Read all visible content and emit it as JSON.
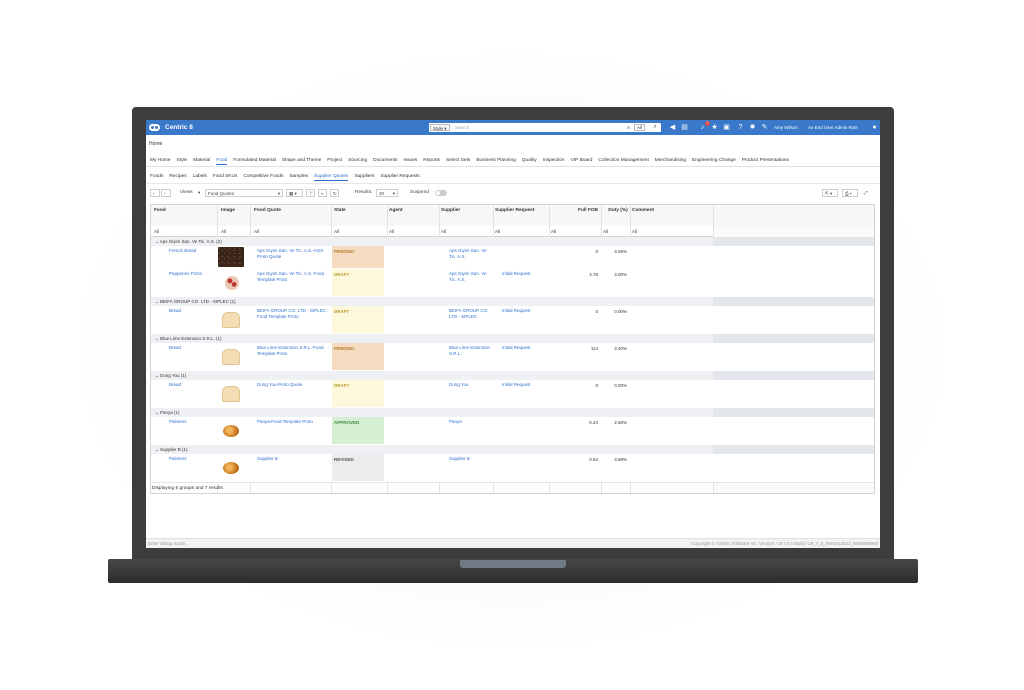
{
  "app": {
    "name": "Centric 8"
  },
  "search": {
    "type": "Style",
    "placeholder": "Search",
    "in_label": "in",
    "scope": "All"
  },
  "user": {
    "name": "Amy Wilson",
    "role": "An End User Admin Role",
    "notifications": "1"
  },
  "breadcrumb": "Home",
  "nav_tabs": [
    "My Home",
    "Style",
    "Material",
    "Food",
    "Formulated Material",
    "Shape and Theme",
    "Project",
    "Sourcing",
    "Documents",
    "Issues",
    "Reports",
    "Select Sets",
    "Business Planning",
    "Quality",
    "Inspection",
    "VIP Board",
    "Collection Management",
    "Merchandising",
    "Engineering Change",
    "Product Presentations"
  ],
  "sub_tabs": [
    "Foods",
    "Recipes",
    "Labels",
    "Food SKUs",
    "Competitive Foods",
    "Samples",
    "Supplier Quotes",
    "Suppliers",
    "Supplier Requests"
  ],
  "toolbar": {
    "views_label": "Views",
    "view_value": "Food Quotes",
    "results_label": "Results:",
    "results_value": "20",
    "suspend_label": "Suspend"
  },
  "columns": [
    "Food",
    "Image",
    "Food Quote",
    "State",
    "Agent",
    "Supplier",
    "Supplier Request",
    "Full FOB",
    "Duty (%)",
    "Comment"
  ],
  "filter_value": "All",
  "groups": [
    {
      "label": "Aps Giyim San. Ve Tic. A.S. (2)",
      "rows": [
        {
          "food": "French Bread",
          "image": "dark-bread",
          "quote": "Aps Giyim San. Ve Tic. A.S.-AGS Proto Quote",
          "state": "PENDING",
          "supplier": "Aps Giyim San. Ve Tic. A.S.",
          "request": "",
          "fob": "0",
          "duty": "3.06%"
        },
        {
          "food": "Pepperoni Pizza",
          "image": "pizza",
          "quote": "Aps Giyim San. Ve Tic. A.S.-Food Template Proto",
          "state": "DRAFT",
          "supplier": "Aps Giyim San. Ve Tic. A.S.",
          "request": "Initial Request",
          "fob": "2.76",
          "duty": "3.00%"
        }
      ]
    },
    {
      "label": "BEIFA GROUP CO. LTD - SIPLEC (1)",
      "rows": [
        {
          "food": "Bread",
          "image": "white-bread",
          "quote": "BEIFA GROUP CO. LTD - SIPLEC - Food Template Proto",
          "state": "DRAFT",
          "supplier": "BEIFA GROUP CO. LTD - SIPLEC",
          "request": "Initial Request",
          "fob": "0",
          "duty": "0.00%"
        }
      ]
    },
    {
      "label": "Blue Lime Extension S.R.L. (1)",
      "rows": [
        {
          "food": "Bread",
          "image": "white-bread",
          "quote": "Blue Lime Extension S.R.L.-Food Template Proto",
          "state": "PENDING",
          "supplier": "Blue Lime Extension S.R.L.",
          "request": "Initial Request",
          "fob": "114",
          "duty": "3.40%"
        }
      ]
    },
    {
      "label": "Dong You (1)",
      "rows": [
        {
          "food": "Bread",
          "image": "white-bread",
          "quote": "Dong You-Proto Quote",
          "state": "DRAFT",
          "supplier": "Dong You",
          "request": "Initial Request",
          "fob": "0",
          "duty": "0.00%"
        }
      ]
    },
    {
      "label": "Panya (1)",
      "rows": [
        {
          "food": "Palmiers",
          "image": "palmiers",
          "quote": "Panya-Food Template Proto",
          "state": "APPROVED",
          "supplier": "Panya",
          "request": "",
          "fob": "0.24",
          "duty": "2.60%"
        }
      ]
    },
    {
      "label": "Supplier B (1)",
      "rows": [
        {
          "food": "Palmiers",
          "image": "palmiers",
          "quote": "Supplier B",
          "state": "REVISED",
          "supplier": "Supplier B",
          "request": "",
          "fob": "0.54",
          "duty": "3.68%"
        }
      ]
    }
  ],
  "footer_text": "Displaying 6 groups and 7 results",
  "status": {
    "left": "Enter debug mode...",
    "right": "Copyright © Centric Software Inc.   Version: C8 7.5.0   Build: C8_7_5_09AUG2022_8eb09909ed"
  },
  "colors": {
    "topbar": "#3a78c9",
    "pending": "#f5dcc0",
    "draft": "#fdf7dc",
    "approved": "#d5efd5",
    "revised": "#ececec"
  }
}
